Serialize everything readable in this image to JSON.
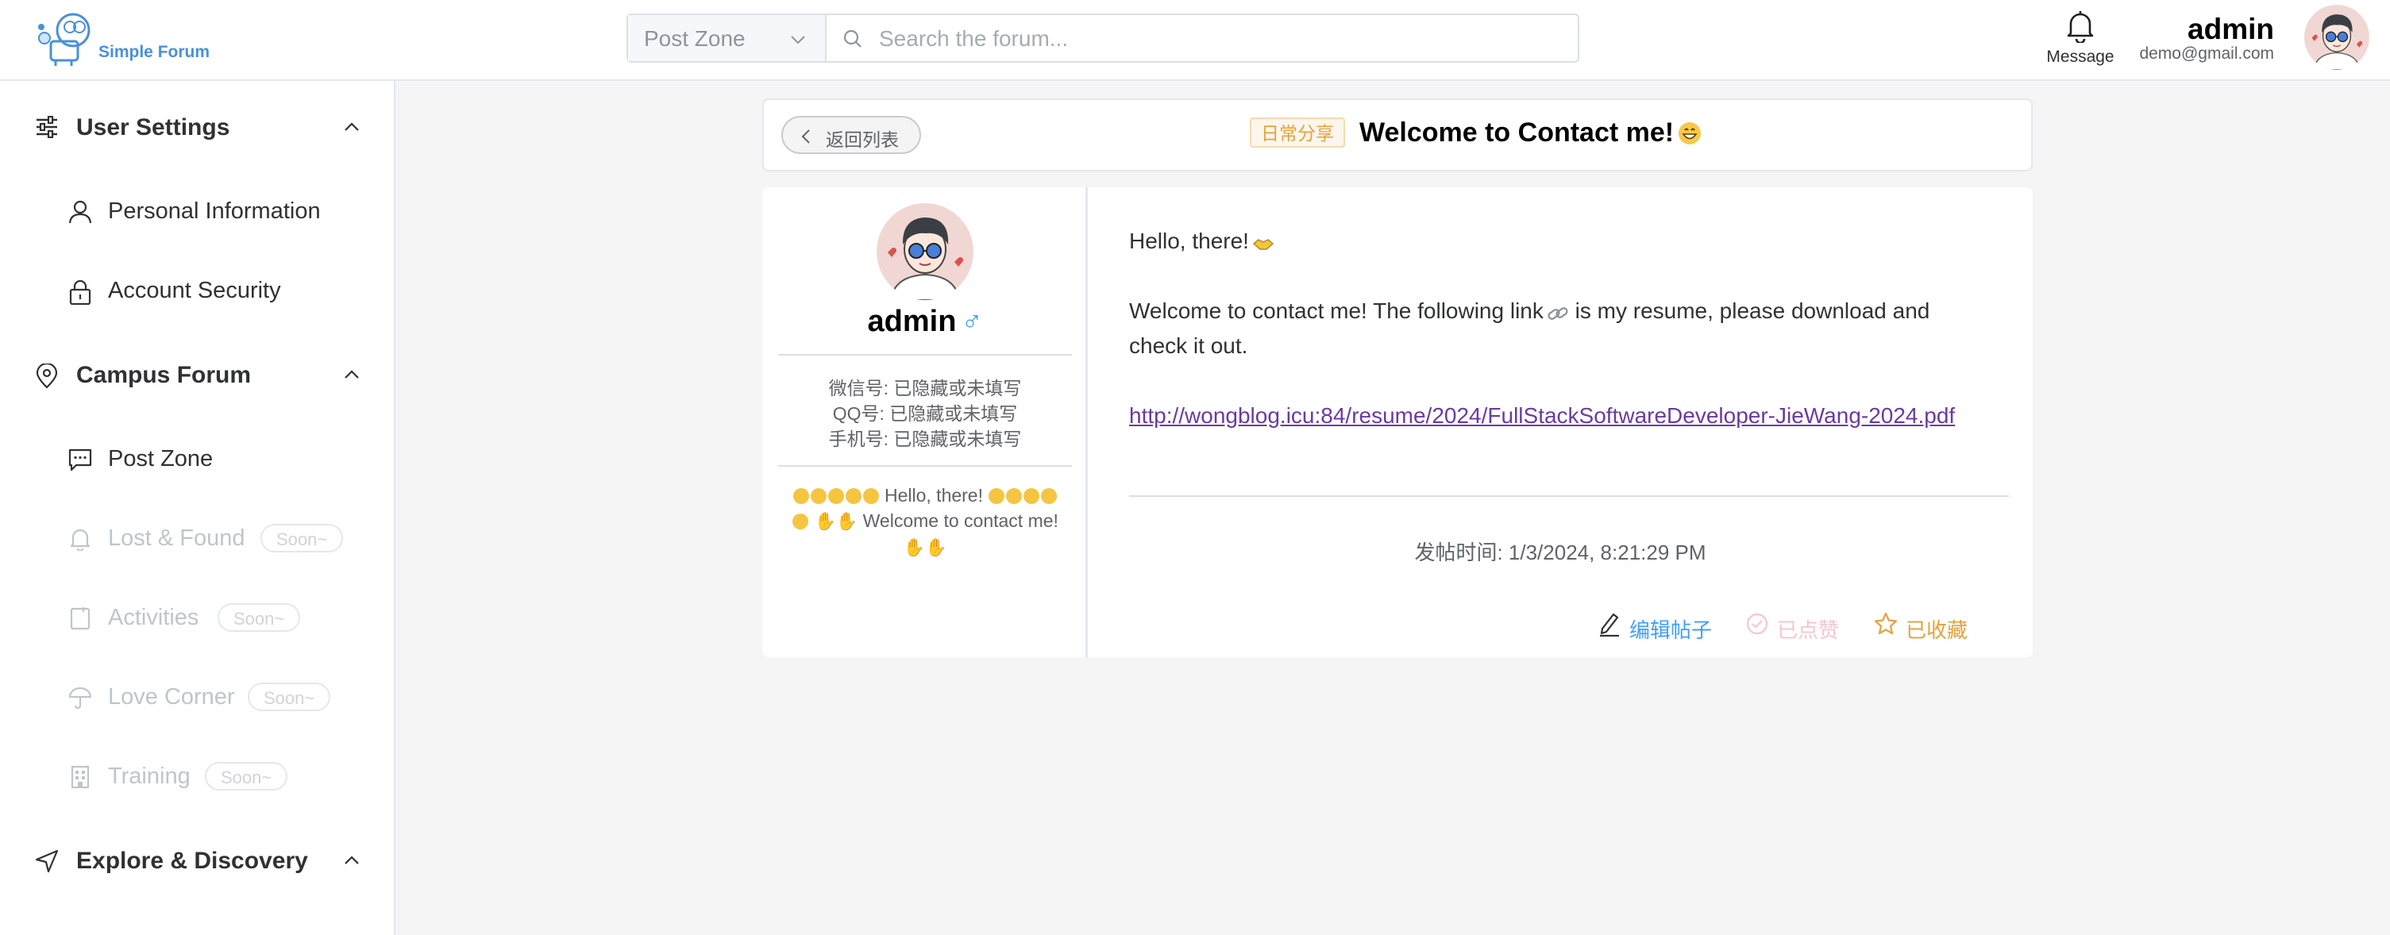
{
  "header": {
    "logo_text": "Simple Forum",
    "search": {
      "zone_selected": "Post Zone",
      "placeholder": "Search the forum..."
    },
    "message_label": "Message",
    "user": {
      "name": "admin",
      "email": "demo@gmail.com"
    }
  },
  "sidebar": {
    "groups": [
      {
        "label": "User Settings",
        "icon": "sliders-icon",
        "expanded": true,
        "items": [
          {
            "label": "Personal Information",
            "icon": "user-icon",
            "disabled": false
          },
          {
            "label": "Account Security",
            "icon": "lock-icon",
            "disabled": false
          }
        ]
      },
      {
        "label": "Campus Forum",
        "icon": "location-pin-icon",
        "expanded": true,
        "items": [
          {
            "label": "Post Zone",
            "icon": "chat-icon",
            "disabled": false
          },
          {
            "label": "Lost & Found",
            "icon": "bell-icon",
            "disabled": true,
            "badge": "Soon~"
          },
          {
            "label": "Activities",
            "icon": "notebook-icon",
            "disabled": true,
            "badge": "Soon~"
          },
          {
            "label": "Love Corner",
            "icon": "umbrella-icon",
            "disabled": true,
            "badge": "Soon~"
          },
          {
            "label": "Training",
            "icon": "building-icon",
            "disabled": true,
            "badge": "Soon~"
          }
        ]
      },
      {
        "label": "Explore & Discovery",
        "icon": "compass-arrow-icon",
        "expanded": true,
        "items": []
      }
    ]
  },
  "post": {
    "back_label": "返回列表",
    "tag": "日常分享",
    "title": "Welcome to Contact me!",
    "author": {
      "name": "admin",
      "gender_symbol": "♂",
      "wechat": "微信号: 已隐藏或未填写",
      "qq": "QQ号: 已隐藏或未填写",
      "phone": "手机号: 已隐藏或未填写",
      "bio_line1": "Hello, there!",
      "bio_line2": "Welcome to contact",
      "bio_line3": "me!"
    },
    "content": {
      "line1": "Hello, there!",
      "line2": "Welcome to contact me! The following link",
      "line2b": " is my resume, please download and",
      "line3": "check it out.",
      "link": "http://wongblog.icu:84/resume/2024/FullStackSoftwareDeveloper-JieWang-2024.pdf"
    },
    "post_time": "发帖时间: 1/3/2024, 8:21:29 PM",
    "actions": {
      "edit": "编辑帖子",
      "like": "已点赞",
      "favorite": "已收藏"
    }
  },
  "colors": {
    "accent": "#409eff",
    "warning": "#e6a23c",
    "link": "#6a3aa3",
    "liked": "#f7c4cf",
    "logo": "#4a90d9"
  }
}
